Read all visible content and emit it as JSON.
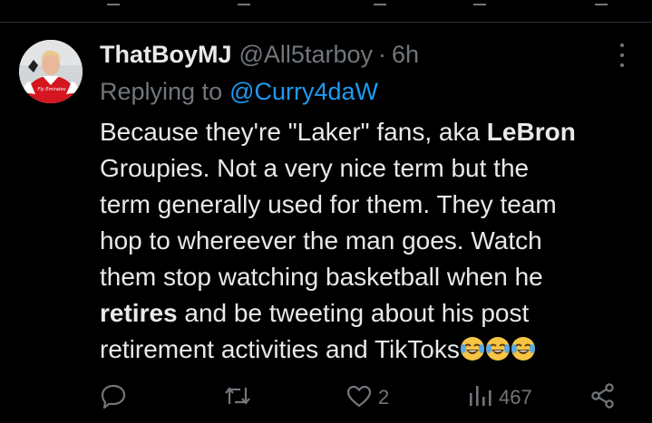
{
  "tweet": {
    "author": {
      "display_name": "ThatBoyMJ",
      "handle": "@All5tarboy",
      "separator": "·",
      "time": "6h"
    },
    "avatar": {
      "shirt_text": "Fly Emirates"
    },
    "reply": {
      "prefix": "Replying to",
      "to_handle": "@Curry4daW"
    },
    "text_lines": [
      {
        "segments": [
          {
            "text": "Because they're \"Laker\" fans, aka ",
            "bold": false
          },
          {
            "text": "LeBron",
            "bold": true
          }
        ]
      },
      {
        "segments": [
          {
            "text": "Groupies. Not a very nice term but the",
            "bold": false
          }
        ]
      },
      {
        "segments": [
          {
            "text": "term generally used for them. They team",
            "bold": false
          }
        ]
      },
      {
        "segments": [
          {
            "text": "hop to whereever the man goes. Watch",
            "bold": false
          }
        ]
      },
      {
        "segments": [
          {
            "text": "them stop watching basketball when he",
            "bold": false
          }
        ]
      },
      {
        "segments": [
          {
            "text": "retires",
            "bold": true
          },
          {
            "text": " and be tweeting about his post",
            "bold": false
          }
        ]
      },
      {
        "segments": [
          {
            "text": "retirement activities and TikToks",
            "bold": false
          }
        ]
      }
    ],
    "emoji": [
      "face-with-tears-of-joy",
      "face-with-tears-of-joy",
      "face-with-tears-of-joy"
    ],
    "actions": {
      "reply": {
        "icon": "reply-icon",
        "count": ""
      },
      "repost": {
        "icon": "repost-icon",
        "count": ""
      },
      "like": {
        "icon": "like-icon",
        "count": "2"
      },
      "views": {
        "icon": "views-icon",
        "count": "467"
      },
      "share": {
        "icon": "share-icon",
        "count": ""
      }
    },
    "colors": {
      "background": "#000000",
      "text": "#e7e9ea",
      "muted": "#71767b",
      "link": "#1d9bf0",
      "divider": "#2f3336"
    }
  }
}
